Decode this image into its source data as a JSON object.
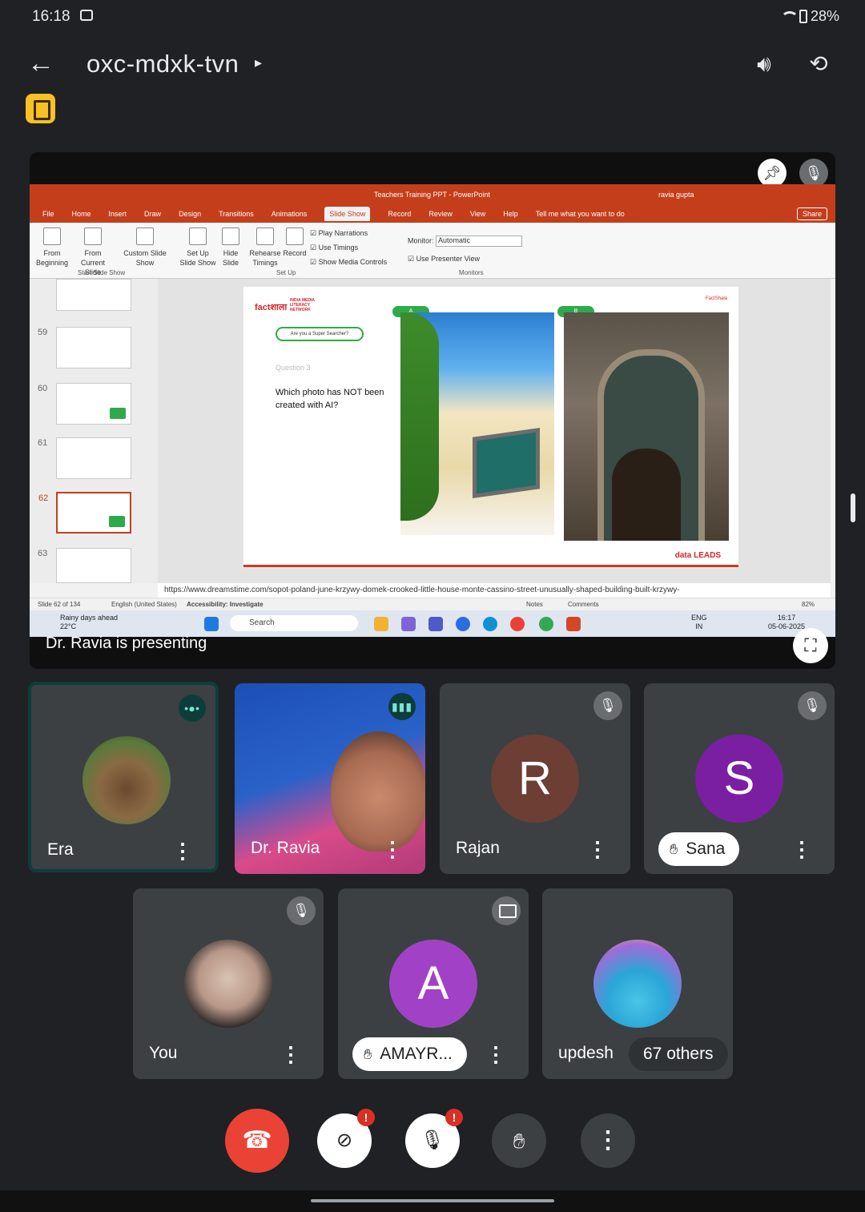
{
  "status_bar": {
    "time": "16:18",
    "battery": "28%"
  },
  "header": {
    "meeting_code": "oxc-mdxk-tvn",
    "caret": "▸"
  },
  "presentation": {
    "presenter_label": "Dr. Ravia is presenting",
    "powerpoint": {
      "window_title": "Teachers Training PPT  -  PowerPoint",
      "user": "ravia gupta",
      "tabs": [
        "File",
        "Home",
        "Insert",
        "Draw",
        "Design",
        "Transitions",
        "Animations",
        "Slide Show",
        "Record",
        "Review",
        "View",
        "Help"
      ],
      "active_tab": "Slide Show",
      "tell_me": "Tell me what you want to do",
      "share": "Share",
      "ribbon": {
        "from_beginning": "From Beginning",
        "from_current": "From Current Slide",
        "custom_show": "Custom Slide Show",
        "group_start": "Start Slide Show",
        "set_up": "Set Up Slide Show",
        "hide": "Hide Slide",
        "rehearse": "Rehearse Timings",
        "record": "Record",
        "play_narrations": "Play Narrations",
        "use_timings": "Use Timings",
        "show_media": "Show Media Controls",
        "group_setup": "Set Up",
        "monitor_label": "Monitor:",
        "monitor_value": "Automatic",
        "presenter_view": "Use Presenter View",
        "group_monitors": "Monitors"
      },
      "thumb_numbers": [
        "59",
        "60",
        "61",
        "62",
        "63"
      ],
      "slide": {
        "pill": "Are you a Super Searcher?",
        "question_num": "Question 3",
        "question": "Which photo has NOT been created with AI?",
        "tag_a": "A",
        "tag_b": "B",
        "footer_logo": "data LEADS",
        "brand": "factशाला",
        "brand_network": "INDIA MEDIA LITERACY NETWORK",
        "factshala_label": "FactShala"
      },
      "notes_url": "https://www.dreamstime.com/sopot-poland-june-krzywy-domek-crooked-little-house-monte-cassino-street-unusually-shaped-building-built-krzywy-",
      "status": {
        "slide_count": "Slide 62 of 134",
        "language": "English (United States)",
        "accessibility": "Accessibility: Investigate",
        "notes": "Notes",
        "comments": "Comments",
        "zoom": "82%"
      },
      "taskbar": {
        "weather_title": "Rainy days ahead",
        "weather_temp": "22°C",
        "search": "Search",
        "lang": "ENG",
        "region": "IN",
        "clock": "16:17",
        "date": "05-06-2025"
      }
    }
  },
  "participants": [
    {
      "name": "Era",
      "type": "photo"
    },
    {
      "name": "Dr. Ravia",
      "type": "video"
    },
    {
      "name": "Rajan",
      "initial": "R",
      "color": "#6d3e34"
    },
    {
      "name": "Sana",
      "initial": "S",
      "color": "#7b1fa2"
    },
    {
      "name": "You",
      "type": "photo"
    },
    {
      "name": "AMAYR...",
      "initial": "A",
      "color": "#a142c6"
    },
    {
      "name": "updesh",
      "others": "67 others"
    }
  ],
  "controls": {
    "end_icon": "phone-end-icon",
    "camera_icon": "camera-off-icon",
    "mic_icon": "mic-off-icon",
    "hand_icon": "raise-hand-icon",
    "more_icon": "more-options-icon",
    "alert_mark": "!"
  },
  "colors": {
    "end_call": "#ea4335",
    "tile_bg": "#3c4043",
    "ppt_red": "#c43e1c",
    "alert": "#d93025"
  }
}
